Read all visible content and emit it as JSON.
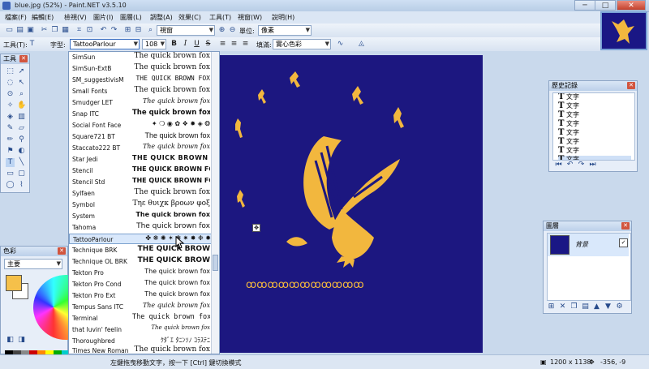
{
  "window": {
    "title": "blue.jpg (52%) - Paint.NET v3.5.10",
    "min": "─",
    "max": "□",
    "close": "✕"
  },
  "menu": [
    "檔案(F)",
    "編輯(E)",
    "檢視(V)",
    "圖片(I)",
    "圖層(L)",
    "調整(A)",
    "效果(C)",
    "工具(T)",
    "視窗(W)",
    "說明(H)"
  ],
  "toolbar1": {
    "zoom_value": "視窗",
    "units_label": "單位:",
    "units_value": "像素"
  },
  "toolbar2": {
    "tool_label": "工具(T):",
    "font_label": "字型:",
    "font_value": "TattooParlour",
    "size_value": "108",
    "bold": "B",
    "italic": "I",
    "underline": "U",
    "strike": "S",
    "fill_label": "填滿:",
    "fill_value": "實心色彩"
  },
  "fonts": [
    {
      "name": "SimSun",
      "sample": "The quick brown fox"
    },
    {
      "name": "SimSun-ExtB",
      "sample": "The quick brown fox"
    },
    {
      "name": "SM_suggestivisM",
      "sample": "THE QUICK BROWN FOX"
    },
    {
      "name": "Small Fonts",
      "sample": "The quick brown fox"
    },
    {
      "name": "Smudger LET",
      "sample": "The quick brown fox"
    },
    {
      "name": "Snap ITC",
      "sample": "The quick brown fox"
    },
    {
      "name": "Social Font Face",
      "sample": "✦ ❍ ◉ ✿ ❖ ✹ ◈ ❂"
    },
    {
      "name": "Square721 BT",
      "sample": "The quick brown fox"
    },
    {
      "name": "Staccato222 BT",
      "sample": "The quick brown fox"
    },
    {
      "name": "Star Jedi",
      "sample": "THE QUICK BROWN FOX"
    },
    {
      "name": "Stencil",
      "sample": "THE QUICK BROWN FOX"
    },
    {
      "name": "Stencil Std",
      "sample": "THE QUICK BROWN FOX"
    },
    {
      "name": "Sylfaen",
      "sample": "The quick brown fox"
    },
    {
      "name": "Symbol",
      "sample": "Τηε θυιχκ βροων φοξ"
    },
    {
      "name": "System",
      "sample": "The quick brown fox"
    },
    {
      "name": "Tahoma",
      "sample": "The quick brown fox"
    },
    {
      "name": "TattooParlour",
      "sample": "✤ ❋ ✺ ✶ ❃ ✷ ✸ ❉ ✹"
    },
    {
      "name": "Technique BRK",
      "sample": "THE QUICK BROW"
    },
    {
      "name": "Technique OL BRK",
      "sample": "THE QUICK BROW"
    },
    {
      "name": "Tekton Pro",
      "sample": "The quick brown fox"
    },
    {
      "name": "Tekton Pro Cond",
      "sample": "The quick brown fox"
    },
    {
      "name": "Tekton Pro Ext",
      "sample": "The quick brown fox"
    },
    {
      "name": "Tempus Sans ITC",
      "sample": "The quick brown fox"
    },
    {
      "name": "Terminal",
      "sample": "The quick brown fox"
    },
    {
      "name": "that luvin' feelin",
      "sample": "The quick brown fox"
    },
    {
      "name": "Thoroughbred",
      "sample": "ｸﾀﾞｴ ﾀﾆﾝｿﾉ ｺﾗｽﾃﾆ"
    },
    {
      "name": "Times New Roman",
      "sample": "The quick brown fox"
    }
  ],
  "tools_panel": {
    "title": "工具"
  },
  "colors_panel": {
    "title": "色彩",
    "mode": "主要"
  },
  "history_panel": {
    "title": "歷史記錄",
    "items": [
      "文字",
      "文字",
      "文字",
      "文字",
      "文字",
      "文字",
      "文字",
      "文字"
    ]
  },
  "layers_panel": {
    "title": "圖層",
    "layer_name": "背景",
    "check": "✓"
  },
  "canvas_text": "ꝏꝏꝏꝏꝏꝏꝏꝏꝏꝏꝏ",
  "status": {
    "hint": "左鍵拖曳移動文字，按一下 [Ctrl] 鍵切換模式",
    "size": "1200 x 1138",
    "coords": "-356, -9"
  },
  "colors": {
    "canvas": "#1c1780",
    "eagle": "#f2b73e",
    "primary": "#f5c04a",
    "secondary": "#ffffff"
  }
}
